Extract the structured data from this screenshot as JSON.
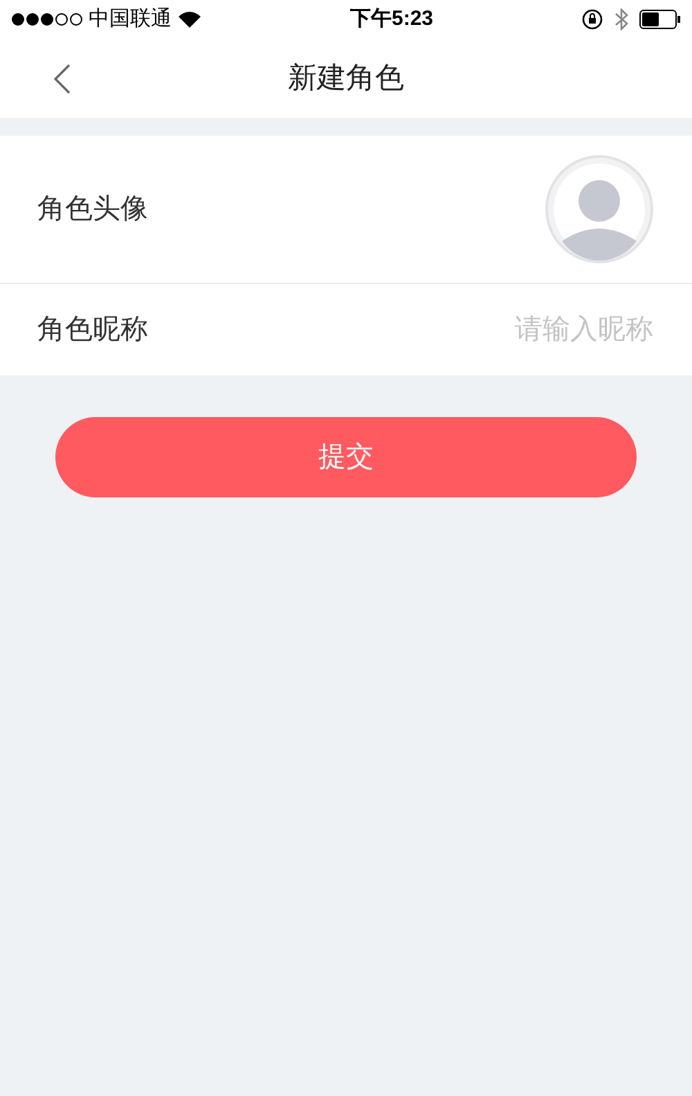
{
  "status_bar": {
    "carrier": "中国联通",
    "time": "下午5:23"
  },
  "nav": {
    "title": "新建角色"
  },
  "form": {
    "avatar_label": "角色头像",
    "nickname_label": "角色昵称",
    "nickname_placeholder": "请输入昵称"
  },
  "submit": {
    "label": "提交"
  }
}
